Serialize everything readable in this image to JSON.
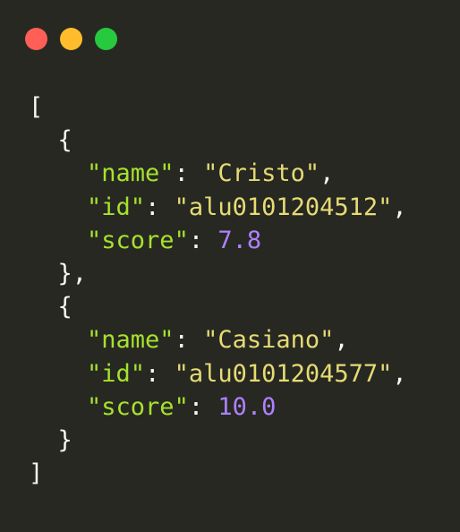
{
  "window_controls": {
    "close": {
      "icon": "close-dot-icon",
      "color": "#ff5f56"
    },
    "minimize": {
      "icon": "minimize-dot-icon",
      "color": "#ffbd2e"
    },
    "maximize": {
      "icon": "maximize-dot-icon",
      "color": "#27c93f"
    }
  },
  "colors": {
    "background": "#272822",
    "punctuation": "#f8f8f2",
    "key": "#a6e22e",
    "string": "#e6db74",
    "number": "#ae81ff"
  },
  "code": {
    "lines": [
      {
        "tokens": [
          {
            "t": "punc",
            "v": "["
          }
        ]
      },
      {
        "tokens": [
          {
            "t": "punc",
            "v": "  {"
          }
        ]
      },
      {
        "tokens": [
          {
            "t": "punc",
            "v": "    "
          },
          {
            "t": "key",
            "v": "\"name\""
          },
          {
            "t": "punc",
            "v": ": "
          },
          {
            "t": "str",
            "v": "\"Cristo\""
          },
          {
            "t": "punc",
            "v": ","
          }
        ]
      },
      {
        "tokens": [
          {
            "t": "punc",
            "v": "    "
          },
          {
            "t": "key",
            "v": "\"id\""
          },
          {
            "t": "punc",
            "v": ": "
          },
          {
            "t": "str",
            "v": "\"alu0101204512\""
          },
          {
            "t": "punc",
            "v": ","
          }
        ]
      },
      {
        "tokens": [
          {
            "t": "punc",
            "v": "    "
          },
          {
            "t": "key",
            "v": "\"score\""
          },
          {
            "t": "punc",
            "v": ": "
          },
          {
            "t": "num",
            "v": "7.8"
          }
        ]
      },
      {
        "tokens": [
          {
            "t": "punc",
            "v": "  },"
          }
        ]
      },
      {
        "tokens": [
          {
            "t": "punc",
            "v": "  {"
          }
        ]
      },
      {
        "tokens": [
          {
            "t": "punc",
            "v": "    "
          },
          {
            "t": "key",
            "v": "\"name\""
          },
          {
            "t": "punc",
            "v": ": "
          },
          {
            "t": "str",
            "v": "\"Casiano\""
          },
          {
            "t": "punc",
            "v": ","
          }
        ]
      },
      {
        "tokens": [
          {
            "t": "punc",
            "v": "    "
          },
          {
            "t": "key",
            "v": "\"id\""
          },
          {
            "t": "punc",
            "v": ": "
          },
          {
            "t": "str",
            "v": "\"alu0101204577\""
          },
          {
            "t": "punc",
            "v": ","
          }
        ]
      },
      {
        "tokens": [
          {
            "t": "punc",
            "v": "    "
          },
          {
            "t": "key",
            "v": "\"score\""
          },
          {
            "t": "punc",
            "v": ": "
          },
          {
            "t": "num",
            "v": "10.0"
          }
        ]
      },
      {
        "tokens": [
          {
            "t": "punc",
            "v": "  }"
          }
        ]
      },
      {
        "tokens": [
          {
            "t": "punc",
            "v": "]"
          }
        ]
      }
    ]
  }
}
